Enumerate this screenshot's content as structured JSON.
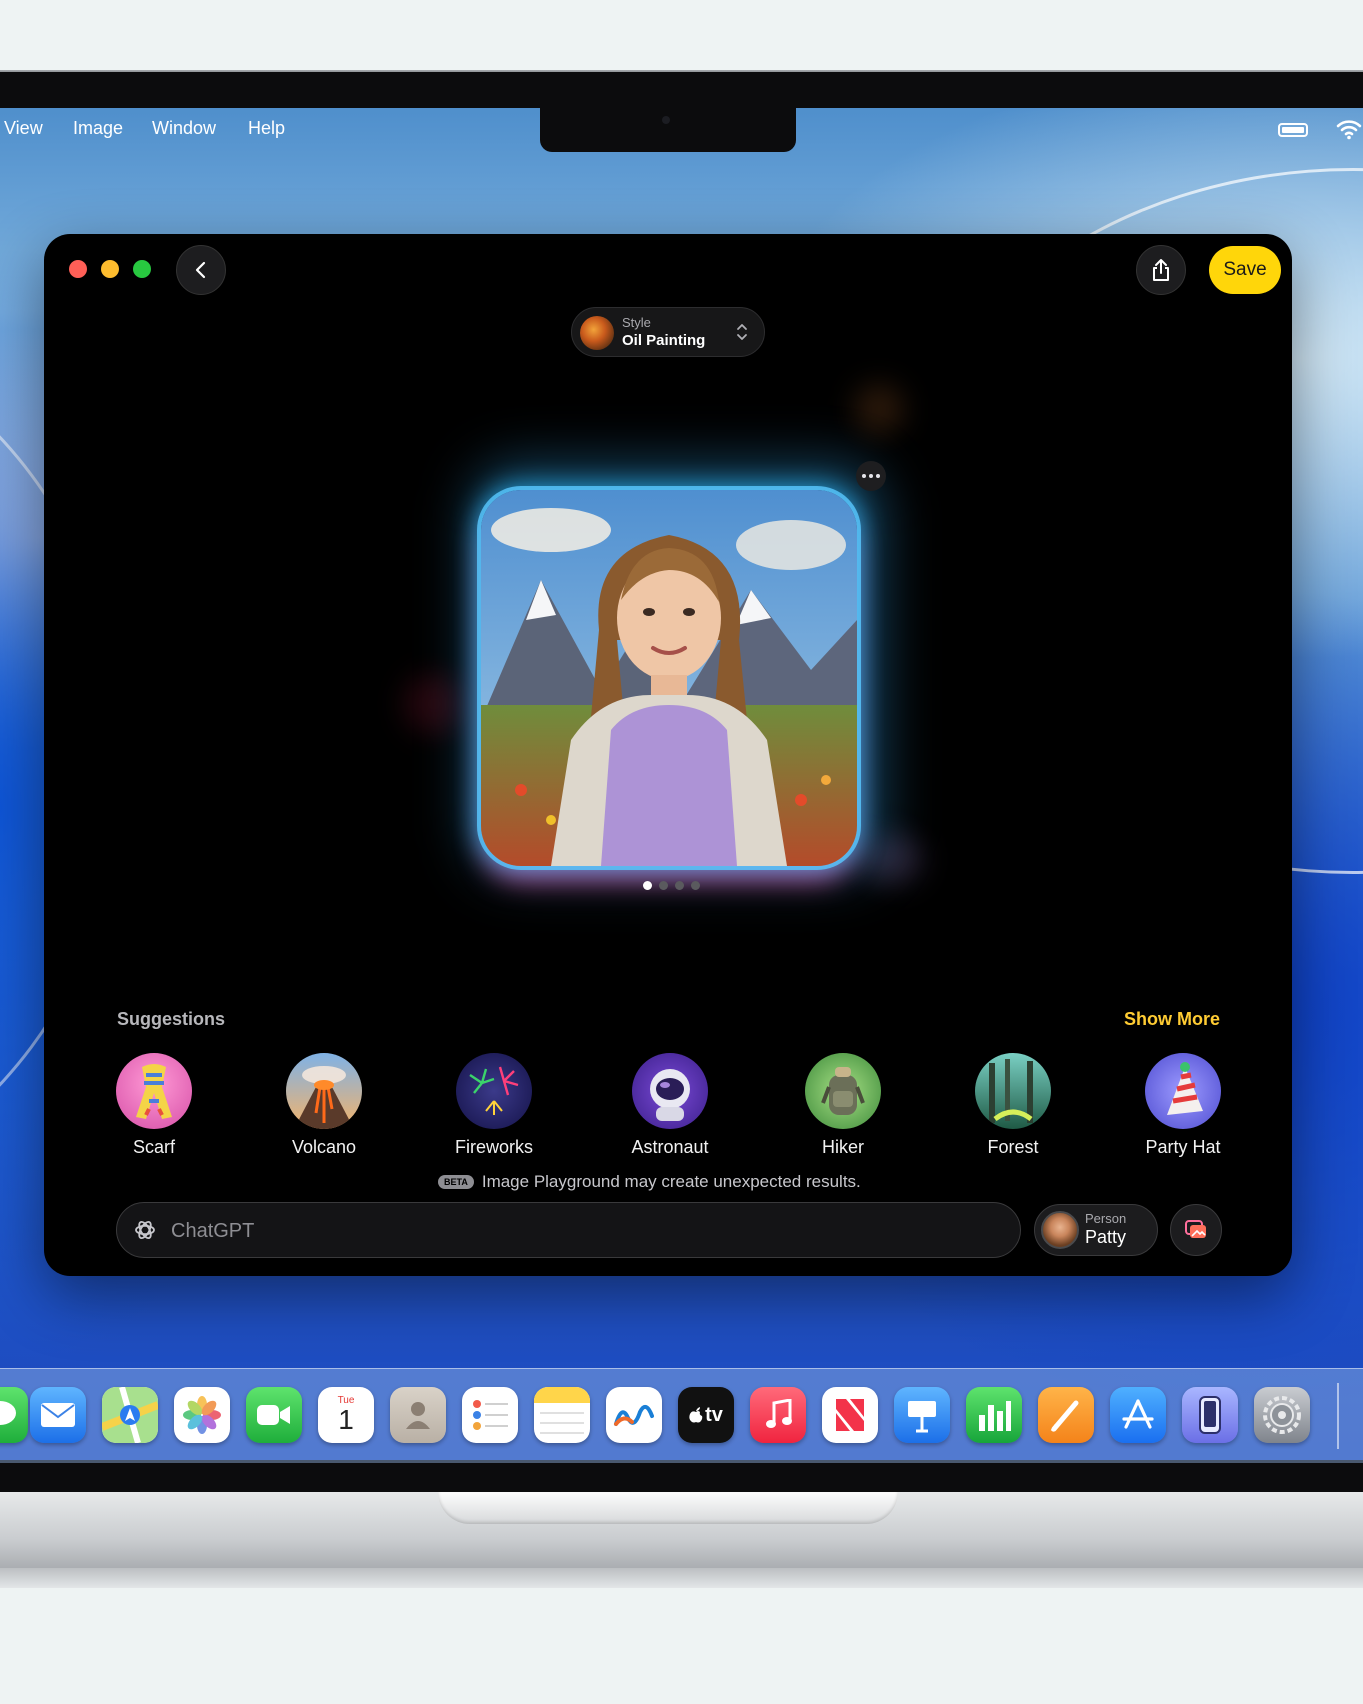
{
  "menubar": {
    "items": [
      "View",
      "Image",
      "Window",
      "Help"
    ]
  },
  "window": {
    "save_label": "Save",
    "style": {
      "label": "Style",
      "value": "Oil Painting"
    },
    "page_dots": {
      "count": 4,
      "active": 1
    },
    "suggestions": {
      "title": "Suggestions",
      "show_more": "Show More",
      "items": [
        {
          "label": "Scarf",
          "icon": "scarf-icon"
        },
        {
          "label": "Volcano",
          "icon": "volcano-icon"
        },
        {
          "label": "Fireworks",
          "icon": "fireworks-icon"
        },
        {
          "label": "Astronaut",
          "icon": "astronaut-icon"
        },
        {
          "label": "Hiker",
          "icon": "backpack-icon"
        },
        {
          "label": "Forest",
          "icon": "forest-icon"
        },
        {
          "label": "Party Hat",
          "icon": "party-hat-icon"
        }
      ]
    },
    "beta": {
      "badge": "BETA",
      "text": "Image Playground may create unexpected results."
    },
    "prompt": {
      "placeholder": "ChatGPT"
    },
    "person": {
      "label": "Person",
      "name": "Patty"
    }
  },
  "dock": {
    "calendar": {
      "day": "Tue",
      "date": "1"
    },
    "tv_label": "tv"
  }
}
